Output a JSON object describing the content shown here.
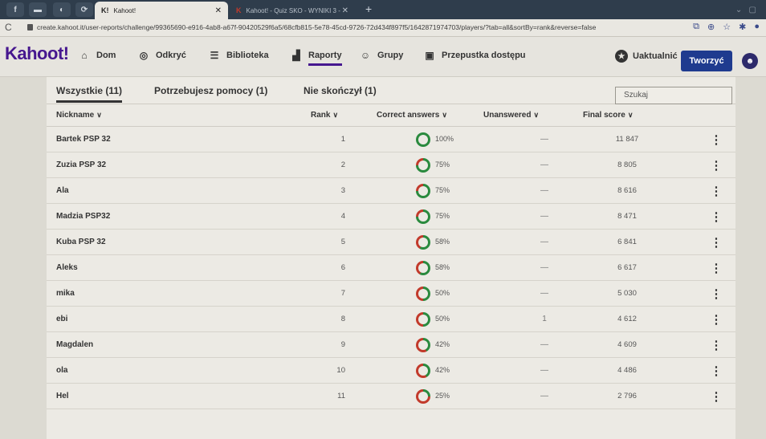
{
  "browser": {
    "tabs": [
      {
        "label": "Kahoot!",
        "icon": "K!",
        "active": true
      },
      {
        "label": "Kahoot! - Quiz SKO - WYNIKI 3 -",
        "icon": "K",
        "active": false
      }
    ],
    "url": "create.kahoot.it/user-reports/challenge/99365690-e916-4ab8-a67f-90420529f6a5/68cfb815-5e78-45cd-9726-72d434f897f5/1642871974703/players/?tab=all&sortBy=rank&reverse=false"
  },
  "nav": {
    "logo": "Kahoot!",
    "items": [
      {
        "label": "Dom",
        "icon": "home-icon",
        "active": false
      },
      {
        "label": "Odkryć",
        "icon": "compass-icon",
        "active": false
      },
      {
        "label": "Biblioteka",
        "icon": "list-icon",
        "active": false
      },
      {
        "label": "Raporty",
        "icon": "bar-chart-icon",
        "active": true
      },
      {
        "label": "Grupy",
        "icon": "group-icon",
        "active": false
      },
      {
        "label": "Przepustka dostępu",
        "icon": "pass-icon",
        "active": false
      }
    ],
    "upgrade": "Uaktualnić",
    "create": "Tworzyć"
  },
  "filters": {
    "tabs": [
      "Wszystkie (11)",
      "Potrzebujesz pomocy (1)",
      "Nie skończył (1)"
    ],
    "active_tab": 0,
    "search_placeholder": "Szukaj"
  },
  "table": {
    "columns": [
      "Nickname",
      "Rank",
      "Correct answers",
      "Unanswered",
      "Final score"
    ],
    "rows": [
      {
        "nickname": "Bartek PSP 32",
        "rank": "1",
        "correct": "100%",
        "correct_value": 100,
        "unanswered": "—",
        "score": "11 847"
      },
      {
        "nickname": "Zuzia PSP 32",
        "rank": "2",
        "correct": "75%",
        "correct_value": 75,
        "unanswered": "—",
        "score": "8 805"
      },
      {
        "nickname": "Ala",
        "rank": "3",
        "correct": "75%",
        "correct_value": 75,
        "unanswered": "—",
        "score": "8 616"
      },
      {
        "nickname": "Madzia PSP32",
        "rank": "4",
        "correct": "75%",
        "correct_value": 75,
        "unanswered": "—",
        "score": "8 471"
      },
      {
        "nickname": "Kuba PSP 32",
        "rank": "5",
        "correct": "58%",
        "correct_value": 58,
        "unanswered": "—",
        "score": "6 841"
      },
      {
        "nickname": "Aleks",
        "rank": "6",
        "correct": "58%",
        "correct_value": 58,
        "unanswered": "—",
        "score": "6 617"
      },
      {
        "nickname": "mika",
        "rank": "7",
        "correct": "50%",
        "correct_value": 50,
        "unanswered": "—",
        "score": "5 030"
      },
      {
        "nickname": "ebi",
        "rank": "8",
        "correct": "50%",
        "correct_value": 50,
        "unanswered": "1",
        "score": "4 612"
      },
      {
        "nickname": "Magdalen",
        "rank": "9",
        "correct": "42%",
        "correct_value": 42,
        "unanswered": "—",
        "score": "4 609"
      },
      {
        "nickname": "ola",
        "rank": "10",
        "correct": "42%",
        "correct_value": 42,
        "unanswered": "—",
        "score": "4 486"
      },
      {
        "nickname": "Hel",
        "rank": "11",
        "correct": "25%",
        "correct_value": 25,
        "unanswered": "—",
        "score": "2 796"
      }
    ]
  },
  "colors": {
    "correct": "#2a8a3e",
    "incorrect": "#c23a2b",
    "brand": "#46178f",
    "create_button": "#1f3b8f"
  }
}
